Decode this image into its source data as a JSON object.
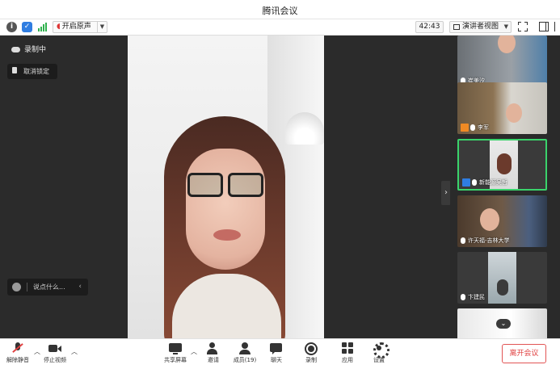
{
  "window": {
    "title": "腾讯会议"
  },
  "toolbar": {
    "original_sound_label": "开启原声",
    "timer": "42:43",
    "view_label": "演讲者视图"
  },
  "main": {
    "recording_label": "录制中",
    "unpin_label": "取消锁定",
    "chat_placeholder": "说点什么..."
  },
  "participants": [
    {
      "name": "崔美汐"
    },
    {
      "name": "李军"
    },
    {
      "name": "新能源吴哲"
    },
    {
      "name": "许天福-吉林大学"
    },
    {
      "name": "卞建民"
    },
    {
      "name": ""
    }
  ],
  "bottombar": {
    "unmute_label": "解除静音",
    "stop_video_label": "停止视频",
    "share_label": "共享屏幕",
    "invite_label": "邀请",
    "members_label": "成员(19)",
    "chat_label": "聊天",
    "record_label": "录制",
    "apps_label": "应用",
    "settings_label": "设置",
    "leave_label": "离开会议"
  }
}
